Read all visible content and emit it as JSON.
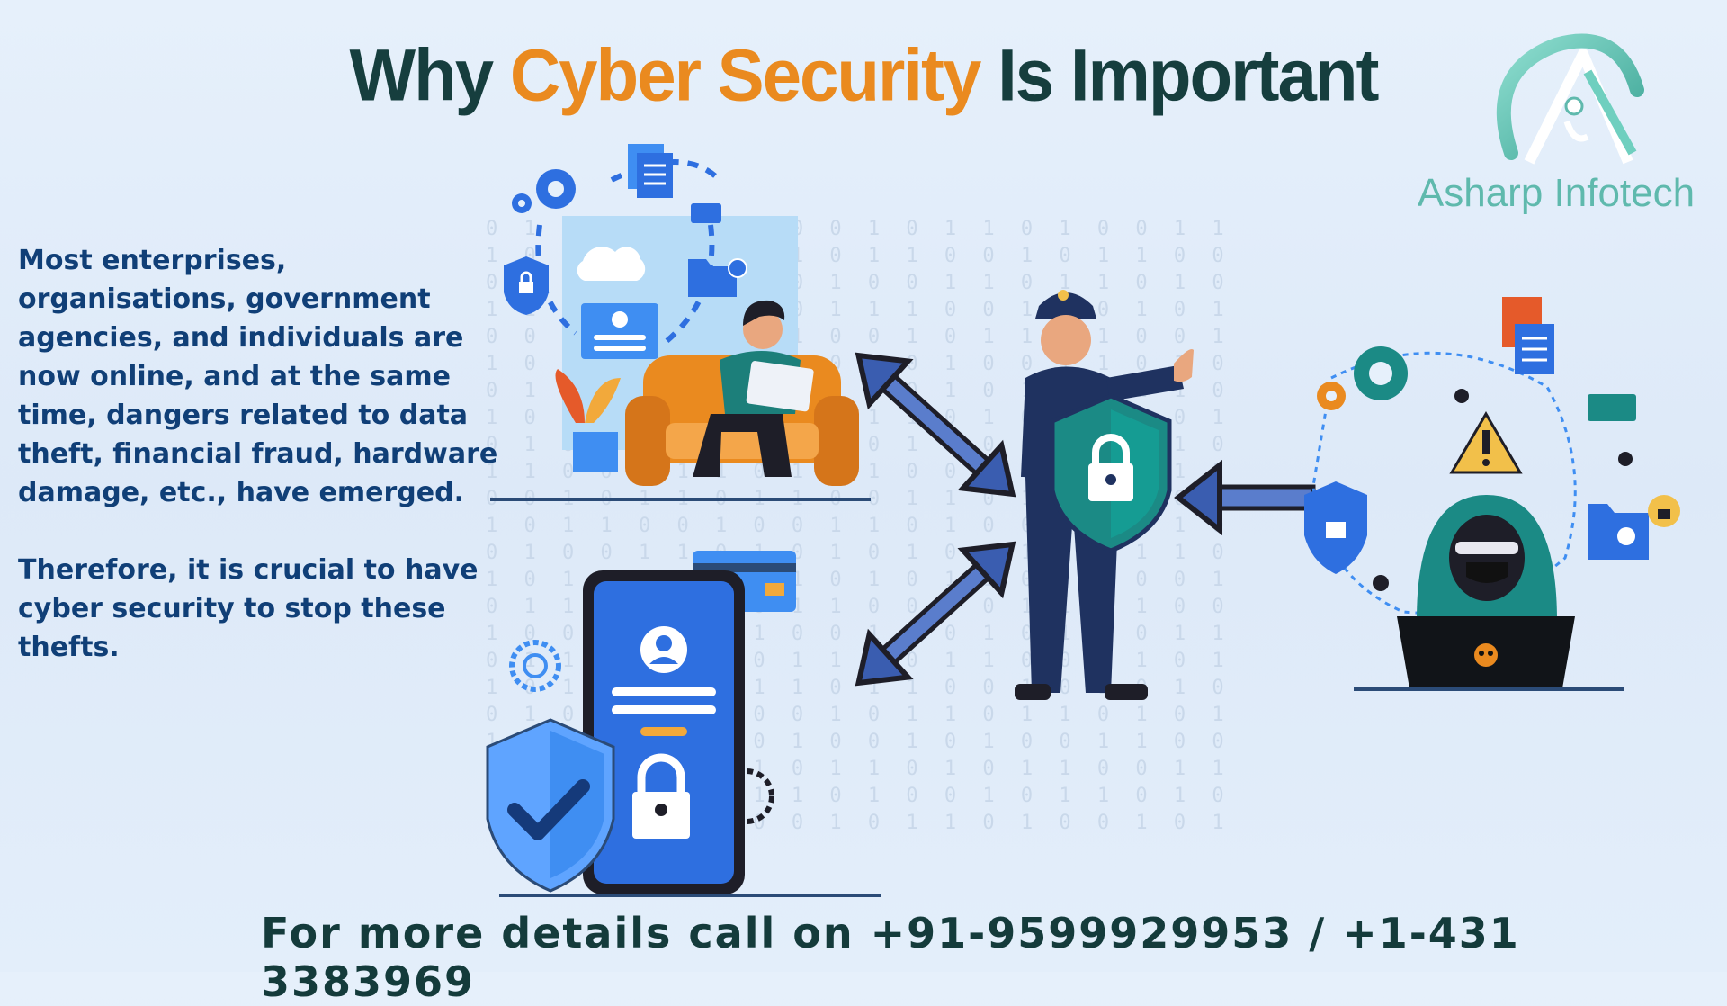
{
  "title": {
    "prefix": "Why",
    "accent": "Cyber Security",
    "suffix": "Is Important"
  },
  "logo": {
    "name": "Asharp Infotech"
  },
  "body": {
    "paragraph1": "Most enterprises, organisations, government agencies, and individuals are now online, and at the same time, dangers related to data theft, financial fraud, hardware damage, etc., have emerged.",
    "paragraph2": "Therefore, it is crucial to have cyber security to stop these thefts."
  },
  "footer": {
    "contact": "For more details call on +91-9599929953 / +1-431 3383969"
  },
  "colors": {
    "title_dark": "#163e3e",
    "title_accent": "#ea8a1f",
    "body_text": "#103f77",
    "brand_teal": "#5fb9ad"
  },
  "icons": [
    "gear-icon",
    "document-icon",
    "cloud-icon",
    "shield-lock-icon",
    "folder-lock-icon",
    "user-profile-icon",
    "double-arrow-icon",
    "police-officer-icon",
    "padlock-icon",
    "hacker-icon",
    "warning-icon",
    "spider-icon",
    "skull-icon",
    "phone-icon",
    "checkmark-shield-icon",
    "credit-card-icon"
  ]
}
